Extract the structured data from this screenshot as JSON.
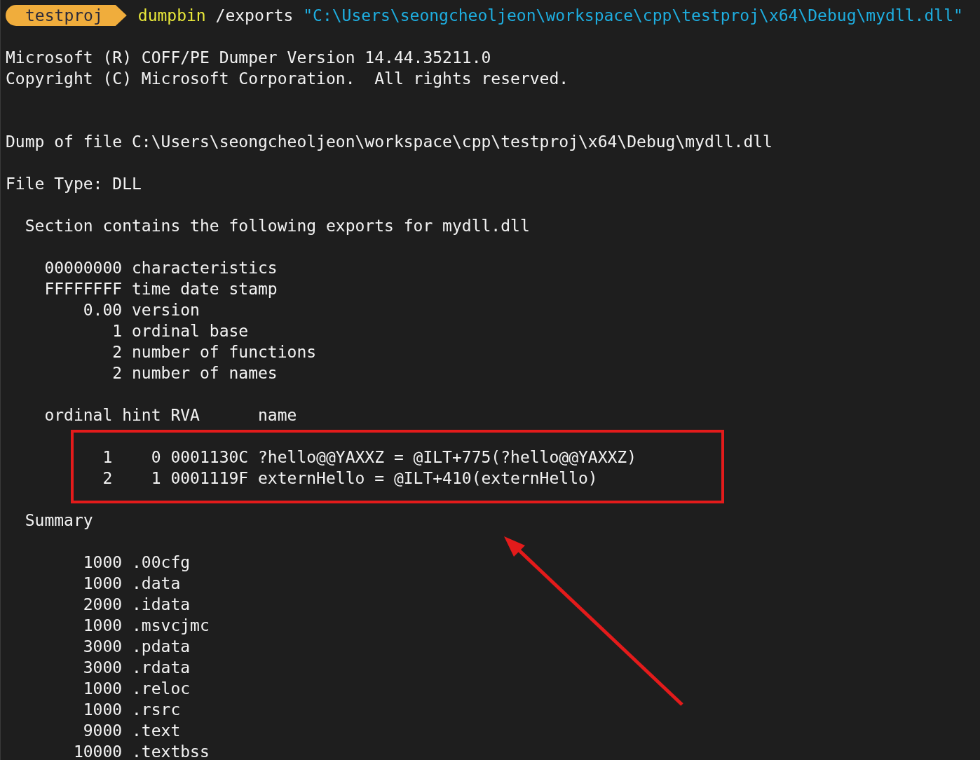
{
  "prompt": {
    "directory": "testproj",
    "command": "dumpbin",
    "option": "/exports",
    "argument": "\"C:\\Users\\seongcheoljeon\\workspace\\cpp\\testproj\\x64\\Debug\\mydll.dll\""
  },
  "output": [
    {
      "lines": [
        "Microsoft (R) COFF/PE Dumper Version 14.44.35211.0",
        "Copyright (C) Microsoft Corporation.  All rights reserved."
      ],
      "highlighted": false
    },
    {
      "lines": [
        "Dump of file C:\\Users\\seongcheoljeon\\workspace\\cpp\\testproj\\x64\\Debug\\mydll.dll"
      ],
      "highlighted": false
    },
    {
      "lines": [
        "File Type: DLL"
      ],
      "highlighted": false
    },
    {
      "lines": [
        "  Section contains the following exports for mydll.dll"
      ],
      "highlighted": false
    },
    {
      "lines": [
        "    00000000 characteristics",
        "    FFFFFFFF time date stamp",
        "        0.00 version",
        "           1 ordinal base",
        "           2 number of functions",
        "           2 number of names"
      ],
      "highlighted": false
    },
    {
      "lines": [
        "    ordinal hint RVA      name"
      ],
      "highlighted": false
    },
    {
      "lines": [
        "          1    0 0001130C ?hello@@YAXXZ = @ILT+775(?hello@@YAXXZ)",
        "          2    1 0001119F externHello = @ILT+410(externHello)"
      ],
      "highlighted": true
    },
    {
      "lines": [
        "  Summary"
      ],
      "highlighted": false
    },
    {
      "lines": [
        "        1000 .00cfg",
        "        1000 .data",
        "        2000 .idata",
        "        1000 .msvcjmc",
        "        3000 .pdata",
        "        3000 .rdata",
        "        1000 .reloc",
        "        1000 .rsrc",
        "        9000 .text",
        "       10000 .textbss"
      ],
      "highlighted": false
    }
  ]
}
